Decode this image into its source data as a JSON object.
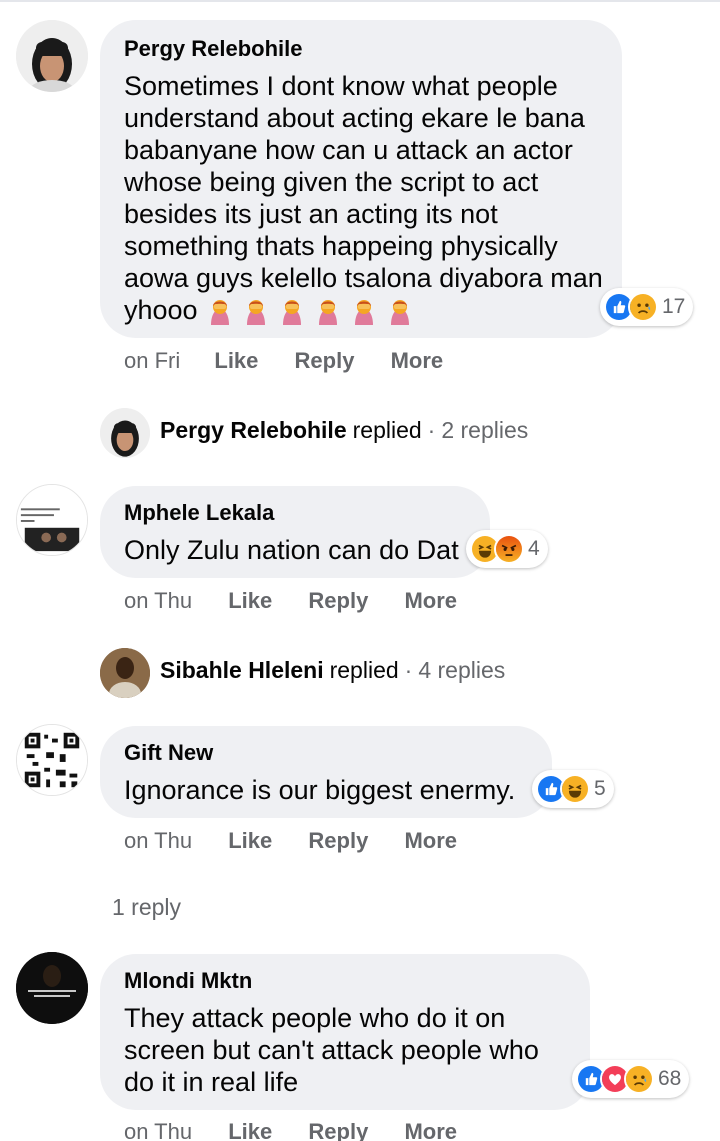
{
  "comments": [
    {
      "author": "Pergy Relebohile",
      "text": "Sometimes I dont know what people understand about acting ekare le bana babanyane how can u attack an actor whose being given the script to act besides its just an acting its not something thats happeing physically aowa guys kelello tsalona diyabora man yhooo",
      "text_emojis": [
        "woman-facepalming",
        "woman-facepalming",
        "woman-facepalming",
        "woman-facepalming",
        "woman-facepalming",
        "woman-facepalming"
      ],
      "reactions": [
        "like",
        "sad"
      ],
      "reaction_count": "17",
      "time": "on Fri",
      "like": "Like",
      "reply": "Reply",
      "more": "More"
    },
    {
      "author": "Mphele Lekala",
      "text": "Only Zulu nation can do Dat",
      "reactions": [
        "haha",
        "angry"
      ],
      "reaction_count": "4",
      "time": "on Thu",
      "like": "Like",
      "reply": "Reply",
      "more": "More"
    },
    {
      "author": "Gift New",
      "text": "Ignorance is our biggest enermy.",
      "reactions": [
        "like",
        "haha"
      ],
      "reaction_count": "5",
      "time": "on Thu",
      "like": "Like",
      "reply": "Reply",
      "more": "More"
    },
    {
      "author": "Mlondi Mktn",
      "text": "They attack people who do it on screen but can't attack people who do it in real life",
      "reactions": [
        "like",
        "love",
        "sad"
      ],
      "reaction_count": "68",
      "time": "on Thu",
      "like": "Like",
      "reply": "Reply",
      "more": "More"
    }
  ],
  "replied_rows": [
    {
      "name": "Pergy Relebohile",
      "word": "replied",
      "separator": "·",
      "count": "2 replies"
    },
    {
      "name": "Sibahle Hleleni",
      "word": "replied",
      "separator": "·",
      "count": "4 replies"
    }
  ],
  "one_reply": "1 reply",
  "colors": {
    "bubble": "#eff0f3",
    "muted": "#65676b",
    "like_blue": "#1877f2",
    "love_red": "#f33e58",
    "emoji_yellow": "#f7b125",
    "angry_orange": "#e9710f"
  }
}
